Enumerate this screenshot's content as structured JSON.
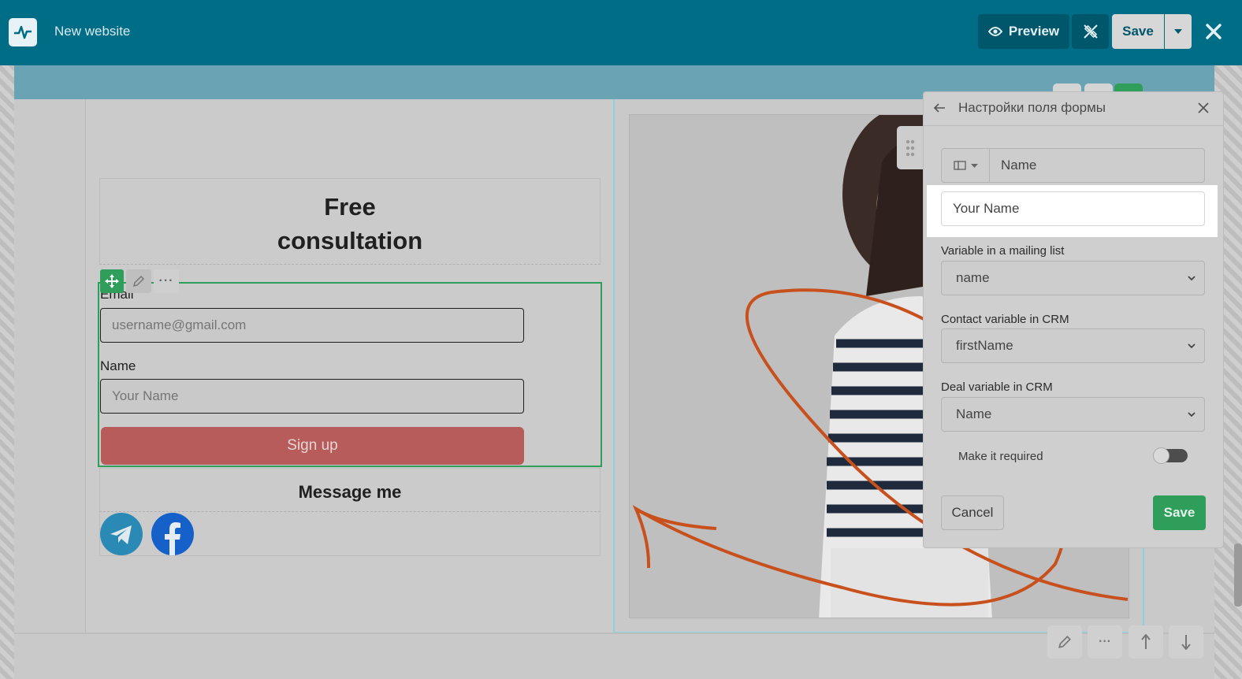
{
  "header": {
    "site_title": "New website",
    "preview_label": "Preview",
    "save_label": "Save"
  },
  "form_block": {
    "title_line1": "Free",
    "title_line2": "consultation",
    "email_label": "Email",
    "email_placeholder": "username@gmail.com",
    "name_label": "Name",
    "name_placeholder": "Your Name",
    "submit_label": "Sign up",
    "message_label": "Message me"
  },
  "settings_panel": {
    "title": "Настройки поля формы",
    "field_name": "Name",
    "placeholder_value": "Your Name",
    "mailing_list_label": "Variable in a mailing list",
    "mailing_list_value": "name",
    "crm_contact_label": "Contact variable in CRM",
    "crm_contact_value": "firstName",
    "crm_deal_label": "Deal variable in CRM",
    "crm_deal_value": "Name",
    "required_label": "Make it required",
    "required": false,
    "cancel_label": "Cancel",
    "save_label": "Save"
  },
  "colors": {
    "topbar": "#006d86",
    "accent_green": "#2e9e5a",
    "signup_red": "#b85b5b",
    "arrow_orange": "#c8501c",
    "telegram": "#2b89b5",
    "facebook": "#1660c9"
  },
  "icons": {
    "logo": "pulse-icon",
    "preview": "eye-icon",
    "design": "design-tools-icon",
    "close": "close-icon",
    "move": "move-icon",
    "edit": "pencil-icon",
    "more": "more-icon",
    "up": "arrow-up-icon",
    "down": "arrow-down-icon",
    "back": "arrow-left-icon",
    "drag": "drag-handle-icon",
    "telegram": "telegram-icon",
    "facebook": "facebook-icon"
  }
}
